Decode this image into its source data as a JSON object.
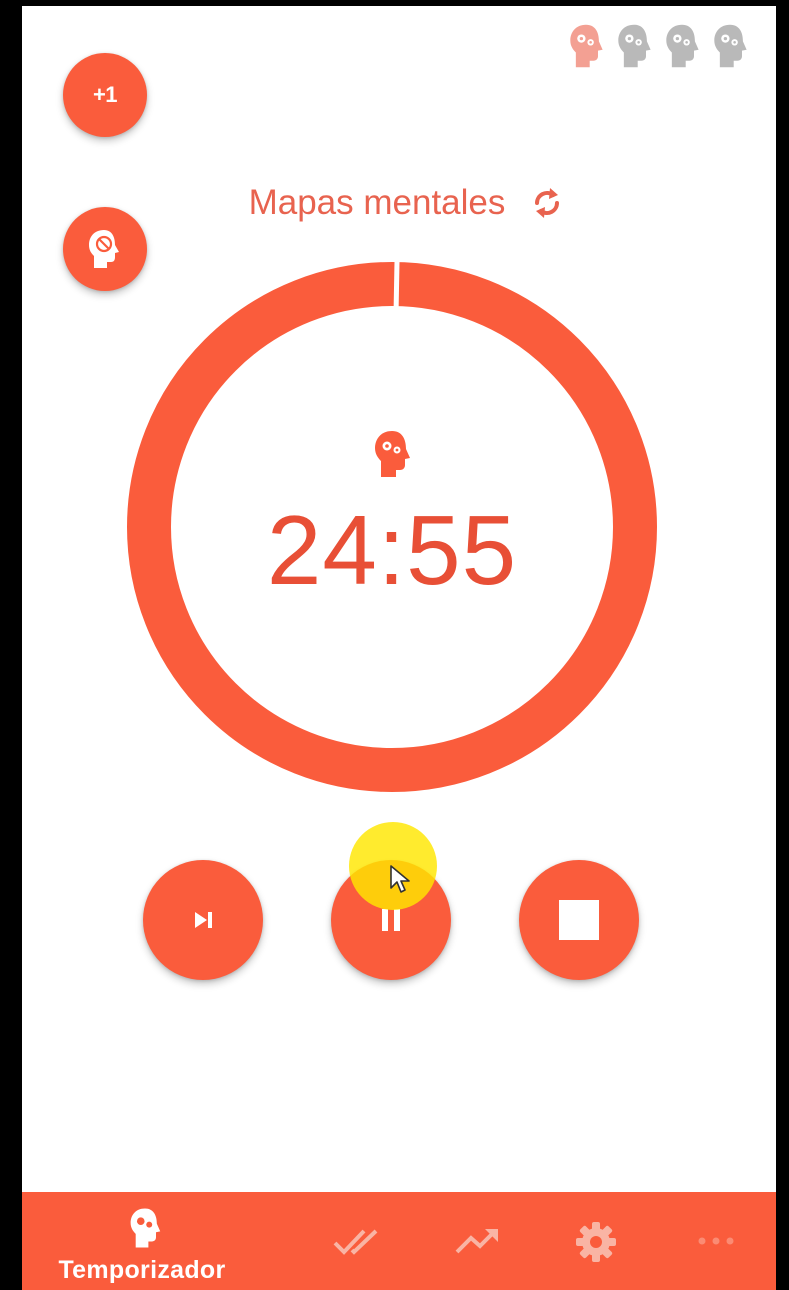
{
  "colors": {
    "accent": "#fa5c3c",
    "accent_text": "#e8634f",
    "timer_text": "#e84f36",
    "session_done": "#f3a093",
    "session_pending": "#b9b9b9",
    "nav_inactive": "#f9b4a4"
  },
  "top": {
    "add_pomodoro_label": "+1",
    "distraction_icon": "head-block-icon",
    "sessions": [
      {
        "state": "done"
      },
      {
        "state": "pending"
      },
      {
        "state": "pending"
      },
      {
        "state": "pending"
      }
    ]
  },
  "task": {
    "name": "Mapas mentales",
    "sync_icon": "sync-icon"
  },
  "timer": {
    "time": "24:55",
    "progress": 0.003,
    "state_icon": "focus-head-icon"
  },
  "controls": {
    "skip_icon": "skip-next-icon",
    "pause_icon": "pause-icon",
    "stop_icon": "stop-icon"
  },
  "bottom_nav": {
    "items": [
      {
        "label": "Temporizador",
        "icon": "focus-head-icon",
        "active": true
      },
      {
        "label": "",
        "icon": "done-all-icon",
        "active": false
      },
      {
        "label": "",
        "icon": "trending-up-icon",
        "active": false
      },
      {
        "label": "",
        "icon": "gear-icon",
        "active": false
      },
      {
        "label": "",
        "icon": "more-icon",
        "active": false
      }
    ]
  }
}
